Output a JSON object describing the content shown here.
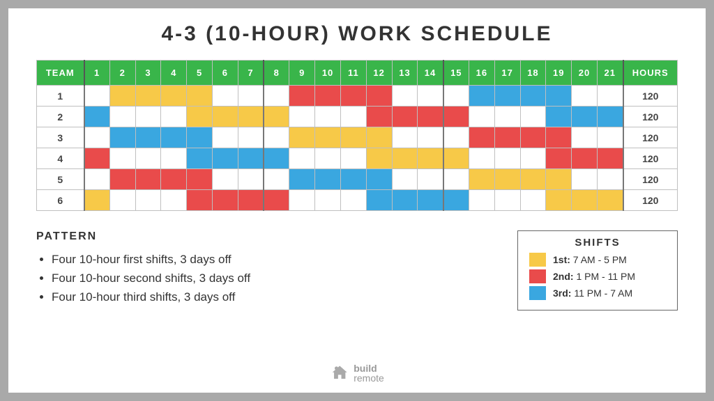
{
  "title": "4-3 (10-HOUR) WORK SCHEDULE",
  "headers": {
    "team": "TEAM",
    "hours": "HOURS",
    "days": [
      "1",
      "2",
      "3",
      "4",
      "5",
      "6",
      "7",
      "8",
      "9",
      "10",
      "11",
      "12",
      "13",
      "14",
      "15",
      "16",
      "17",
      "18",
      "19",
      "20",
      "21"
    ]
  },
  "teams": [
    {
      "name": "1",
      "hours": "120",
      "pattern": [
        "",
        "1",
        "1",
        "1",
        "1",
        "",
        "",
        "",
        "2",
        "2",
        "2",
        "2",
        "",
        "",
        "",
        "3",
        "3",
        "3",
        "3",
        "",
        ""
      ]
    },
    {
      "name": "2",
      "hours": "120",
      "pattern": [
        "3",
        "",
        "",
        "",
        "1",
        "1",
        "1",
        "1",
        "",
        "",
        "",
        "2",
        "2",
        "2",
        "2",
        "",
        "",
        "",
        "3",
        "3",
        "3"
      ]
    },
    {
      "name": "3",
      "hours": "120",
      "pattern": [
        "",
        "3",
        "3",
        "3",
        "3",
        "",
        "",
        "",
        "1",
        "1",
        "1",
        "1",
        "",
        "",
        "",
        "2",
        "2",
        "2",
        "2",
        "",
        ""
      ]
    },
    {
      "name": "4",
      "hours": "120",
      "pattern": [
        "2",
        "",
        "",
        "",
        "3",
        "3",
        "3",
        "3",
        "",
        "",
        "",
        "1",
        "1",
        "1",
        "1",
        "",
        "",
        "",
        "2",
        "2",
        "2"
      ]
    },
    {
      "name": "5",
      "hours": "120",
      "pattern": [
        "",
        "2",
        "2",
        "2",
        "2",
        "",
        "",
        "",
        "3",
        "3",
        "3",
        "3",
        "",
        "",
        "",
        "1",
        "1",
        "1",
        "1",
        "",
        ""
      ]
    },
    {
      "name": "6",
      "hours": "120",
      "pattern": [
        "1",
        "",
        "",
        "",
        "2",
        "2",
        "2",
        "2",
        "",
        "",
        "",
        "3",
        "3",
        "3",
        "3",
        "",
        "",
        "",
        "1",
        "1",
        "1"
      ]
    }
  ],
  "pattern": {
    "heading": "PATTERN",
    "items": [
      "Four 10-hour first shifts, 3 days off",
      "Four 10-hour second shifts, 3 days off",
      "Four 10-hour third shifts, 3 days off"
    ]
  },
  "legend": {
    "heading": "SHIFTS",
    "items": [
      {
        "class": "shift-1",
        "label": "1st:",
        "time": "7 AM - 5 PM"
      },
      {
        "class": "shift-2",
        "label": "2nd:",
        "time": "1 PM - 11 PM"
      },
      {
        "class": "shift-3",
        "label": "3rd:",
        "time": "11 PM - 7 AM"
      }
    ]
  },
  "logo": {
    "line1": "build",
    "line2": "remote"
  },
  "colors": {
    "1": "#f7c948",
    "2": "#e94b4b",
    "3": "#3aa7e0"
  }
}
